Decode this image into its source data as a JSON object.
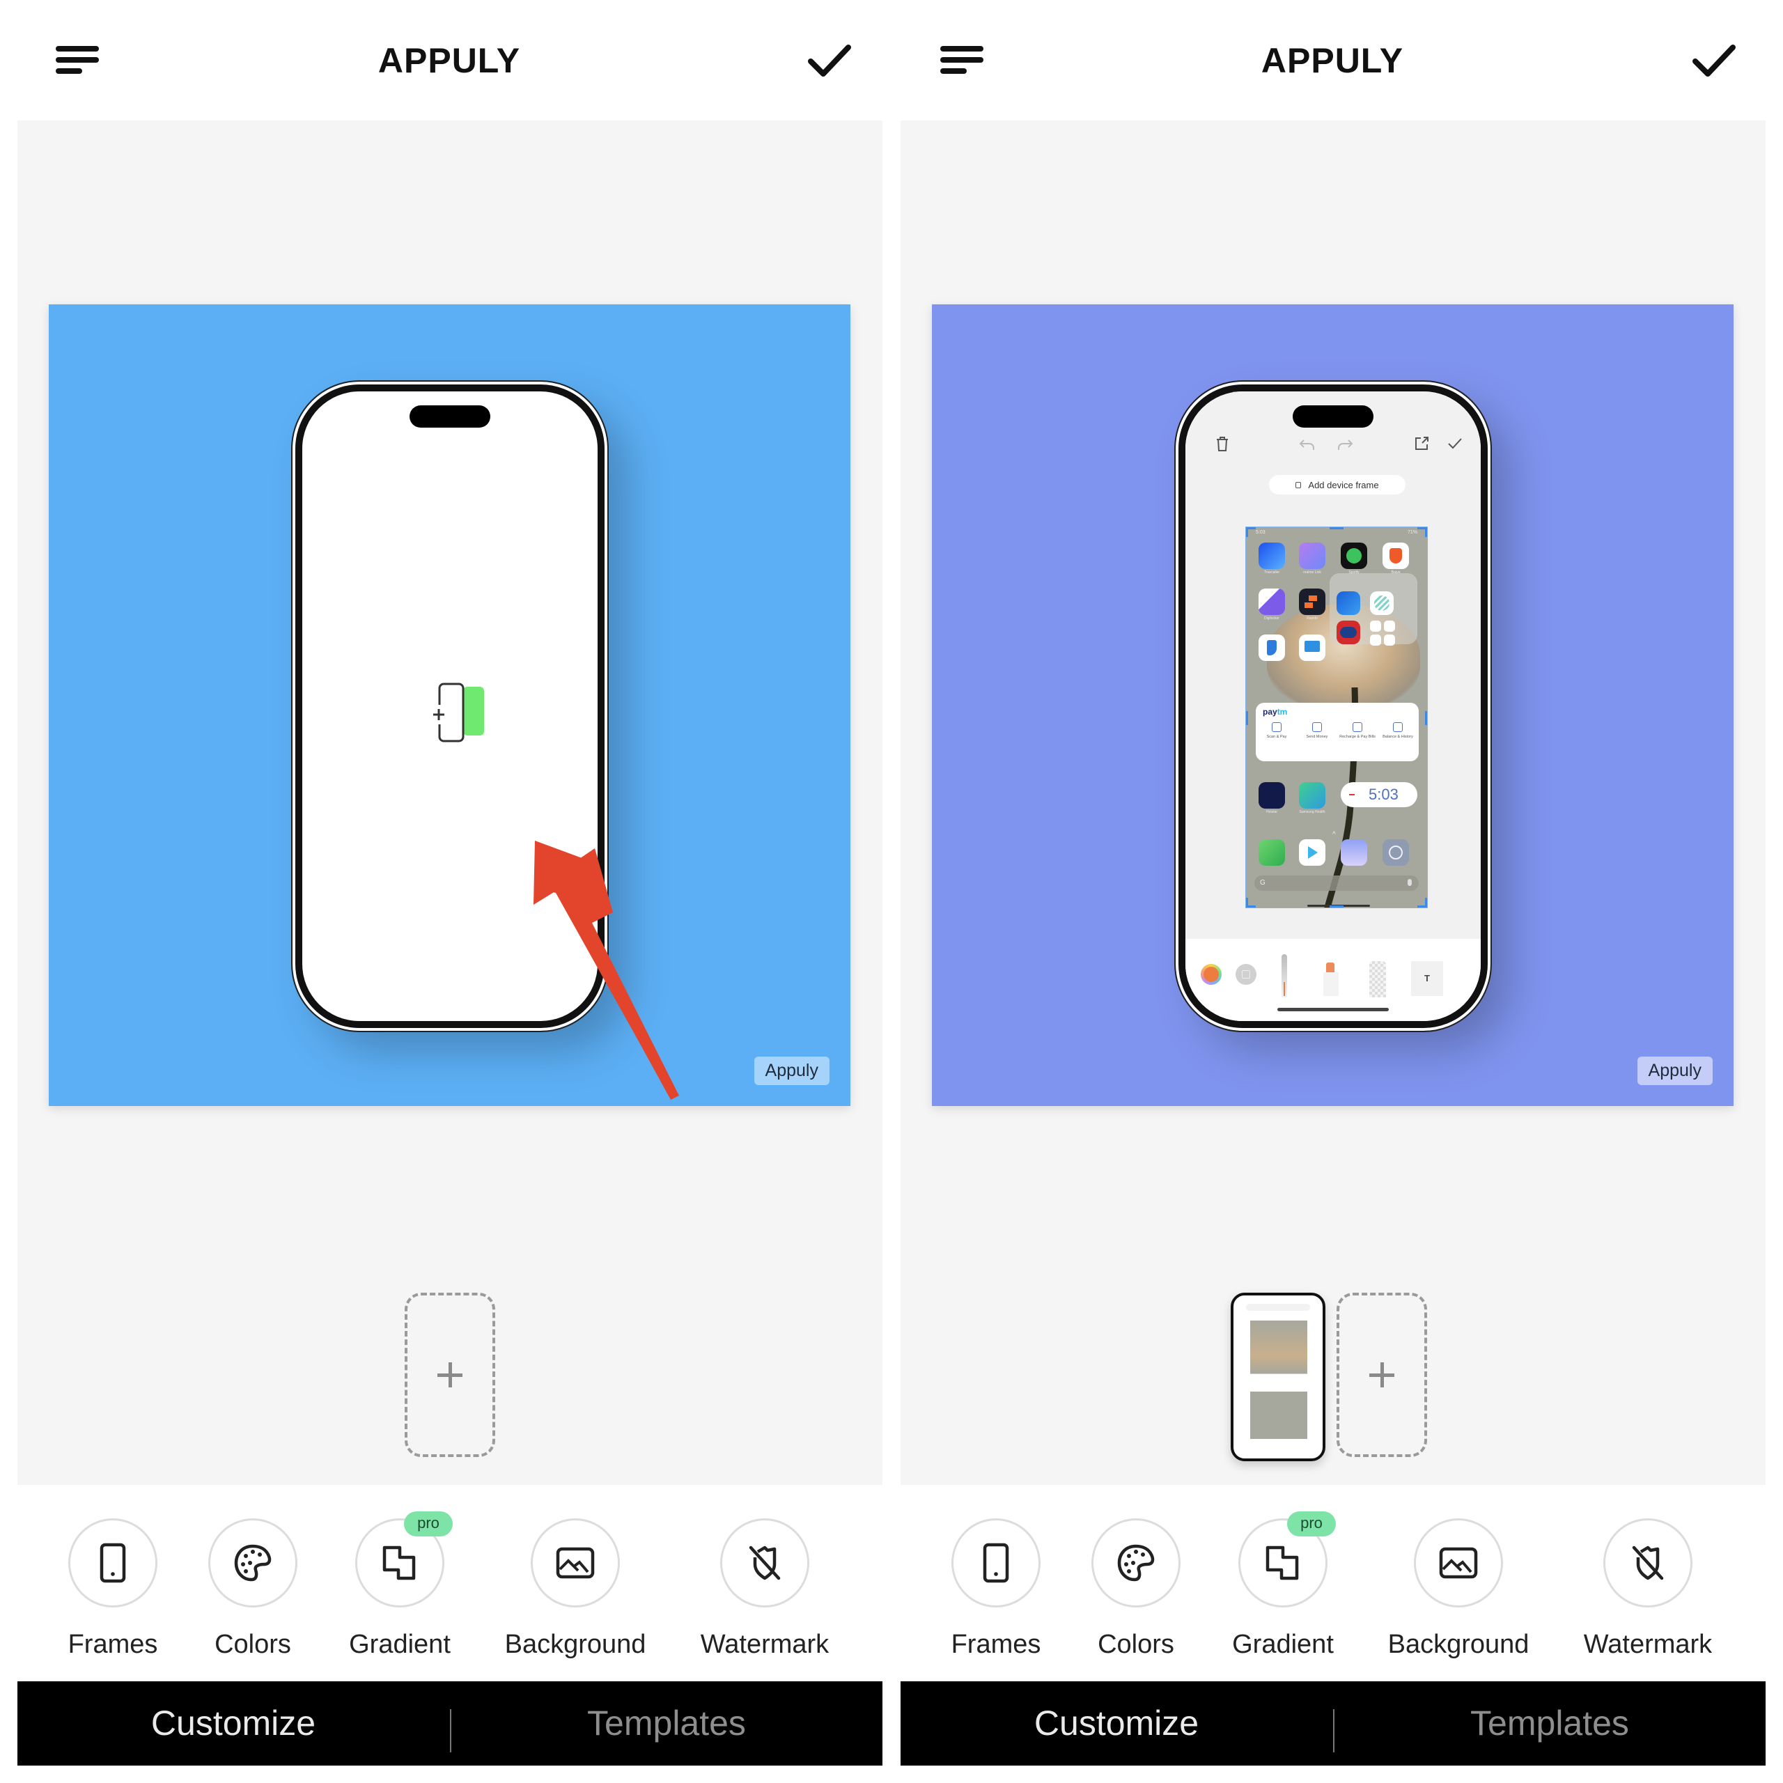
{
  "panels": [
    {
      "id": "left",
      "header": {
        "title": "APPULY",
        "menu_icon": "menu-icon",
        "confirm_icon": "check-icon"
      },
      "canvas": {
        "background_color": "#5caff5",
        "device_screen_state": "empty",
        "add_screenshot_icon": "add-screenshot-icon",
        "annotation": "red-arrow-pointing-to-phone",
        "annotation_color": "#e2452b",
        "watermark": "Appuly",
        "watermark_bg": "#a6d3f9"
      },
      "slots": {
        "thumbnails": 0,
        "add_slot_label": "+"
      },
      "options": [
        {
          "label": "Frames",
          "icon": "phone-frame-icon"
        },
        {
          "label": "Colors",
          "icon": "palette-icon"
        },
        {
          "label": "Gradient",
          "icon": "gradient-icon",
          "badge": "pro"
        },
        {
          "label": "Background",
          "icon": "image-icon"
        },
        {
          "label": "Watermark",
          "icon": "shield-off-icon"
        }
      ],
      "tabs": [
        {
          "label": "Customize",
          "active": true
        },
        {
          "label": "Templates",
          "active": false
        }
      ]
    },
    {
      "id": "right",
      "header": {
        "title": "APPULY",
        "menu_icon": "menu-icon",
        "confirm_icon": "check-icon"
      },
      "canvas": {
        "background_color": "#7f94ef",
        "device_screen_state": "screenshot",
        "watermark": "Appuly",
        "watermark_bg": "#c3cdf7",
        "inner_editor": {
          "toolbar_icons": [
            "trash-icon",
            "undo-icon",
            "redo-icon",
            "share-icon",
            "check-icon"
          ],
          "device_frame_button": "Add device frame",
          "status_time": "5:03",
          "status_battery": "71%",
          "apps_row1": [
            "Truecaller",
            "realme Link",
            "Spotify",
            "Brave"
          ],
          "apps_row2": [
            "Digilocker",
            "Rapido"
          ],
          "apps_row3": [
            "Bing",
            "Desktop Widget"
          ],
          "paytm_title_a": "pay",
          "paytm_title_b": "tm",
          "paytm_actions": [
            "Scan & Pay",
            "Send Money",
            "Recharge & Pay Bills",
            "Balance & History"
          ],
          "apps_row4": [
            "Hotstar",
            "Samsung Health"
          ],
          "clock_time": "5:03",
          "dock": [
            "Phone",
            "Play Store",
            "Gallery",
            "Settings"
          ],
          "search_letter": "G",
          "tray_tools": [
            "color-picker",
            "shape-tool",
            "pen-tool",
            "marker-tool",
            "eraser-tool",
            "text-tool"
          ],
          "text_tool_label": "T"
        }
      },
      "slots": {
        "thumbnails": 1,
        "add_slot_label": "+"
      },
      "options": [
        {
          "label": "Frames",
          "icon": "phone-frame-icon"
        },
        {
          "label": "Colors",
          "icon": "palette-icon"
        },
        {
          "label": "Gradient",
          "icon": "gradient-icon",
          "badge": "pro"
        },
        {
          "label": "Background",
          "icon": "image-icon"
        },
        {
          "label": "Watermark",
          "icon": "shield-off-icon"
        }
      ],
      "tabs": [
        {
          "label": "Customize",
          "active": true
        },
        {
          "label": "Templates",
          "active": false
        }
      ]
    }
  ]
}
